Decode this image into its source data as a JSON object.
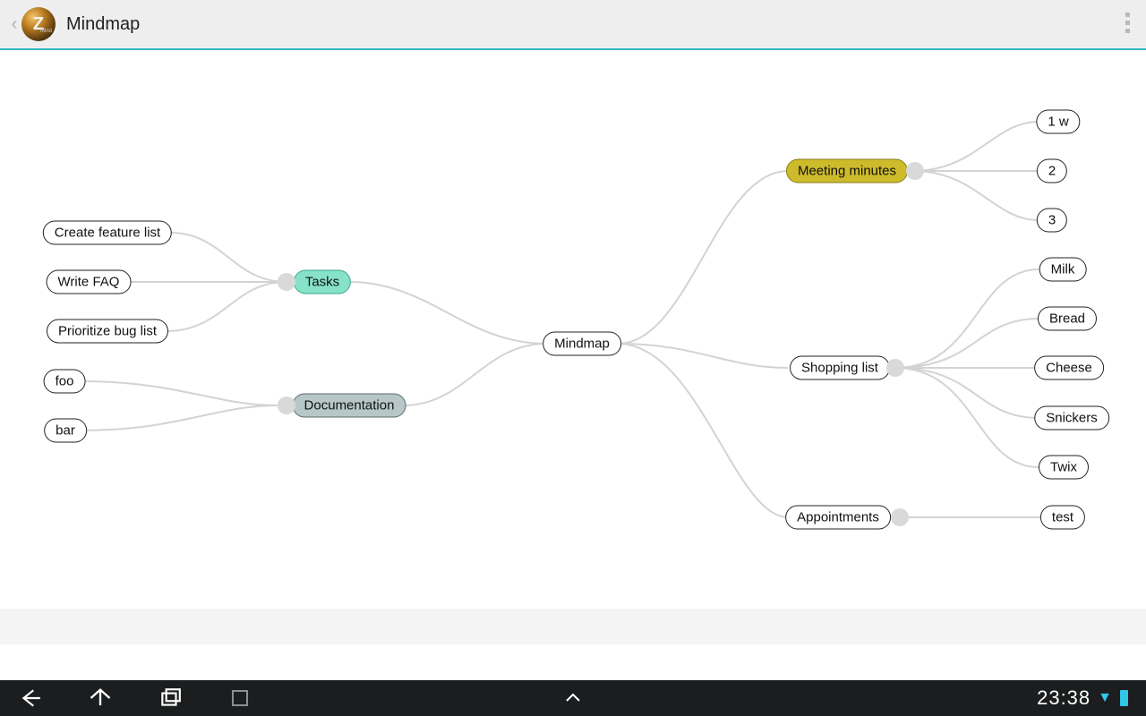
{
  "app": {
    "title": "Mindmap"
  },
  "statusbar": {
    "time": "23:38"
  },
  "nodes": {
    "root": {
      "label": "Mindmap"
    },
    "tasks": {
      "label": "Tasks"
    },
    "documentation": {
      "label": "Documentation"
    },
    "meeting": {
      "label": "Meeting minutes"
    },
    "shopping": {
      "label": "Shopping list"
    },
    "appointments": {
      "label": "Appointments"
    },
    "create_feature": {
      "label": "Create feature list"
    },
    "write_faq": {
      "label": "Write FAQ"
    },
    "prioritize": {
      "label": "Prioritize bug list"
    },
    "foo": {
      "label": "foo"
    },
    "bar": {
      "label": "bar"
    },
    "m1": {
      "label": "1 w"
    },
    "m2": {
      "label": "2"
    },
    "m3": {
      "label": "3"
    },
    "milk": {
      "label": "Milk"
    },
    "bread": {
      "label": "Bread"
    },
    "cheese": {
      "label": "Cheese"
    },
    "snickers": {
      "label": "Snickers"
    },
    "twix": {
      "label": "Twix"
    },
    "test": {
      "label": "test"
    }
  }
}
